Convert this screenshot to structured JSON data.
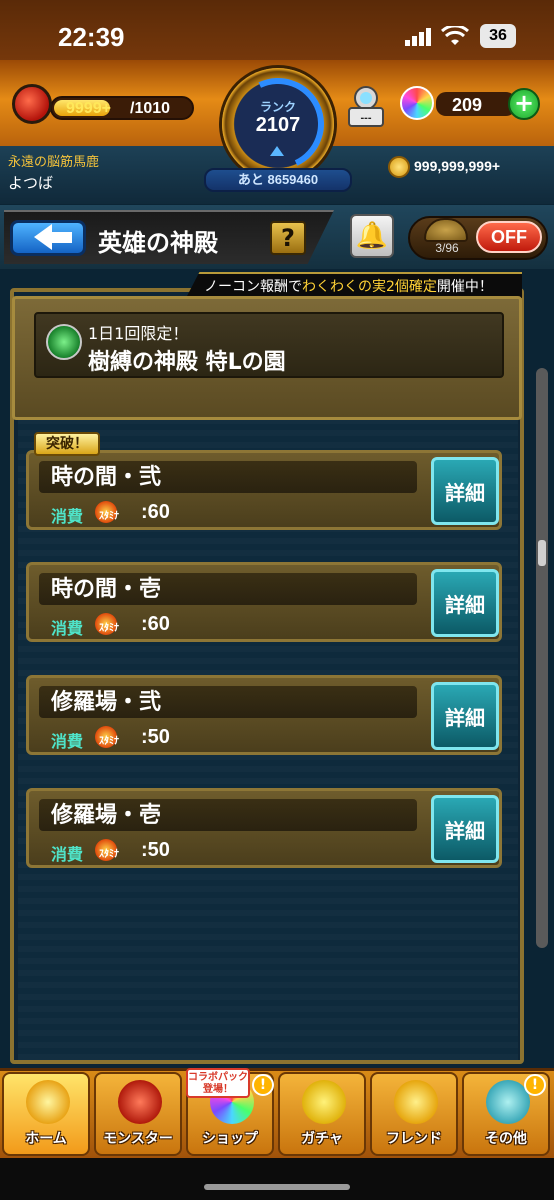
{
  "status_bar": {
    "time": "22:39",
    "battery": "36"
  },
  "hud": {
    "stamina_current": "9999+",
    "stamina_max": "/1010",
    "rank_label": "ランク",
    "rank_value": "2107",
    "rank_next": "あと 8659460",
    "machine_value": "---",
    "orb_count": "209",
    "plus_label": "+",
    "player_title": "永遠の脳筋馬鹿",
    "player_name": "よつば",
    "coins": "999,999,999+"
  },
  "header": {
    "title": "英雄の神殿",
    "help_label": "?",
    "auto_count": "3/96",
    "auto_toggle": "OFF"
  },
  "notice": {
    "pre": "ノーコン報酬で",
    "highlight": "わくわくの実2個確定",
    "post": "開催中！"
  },
  "event": {
    "subtitle": "1日1回限定！",
    "title": "樹縛の神殿 特Lの園"
  },
  "break_badge": "突破！",
  "quests": [
    {
      "name": "時の間・弐",
      "cost_label": "消費",
      "stamina_label": "ｽﾀﾐﾅ",
      "cost": ":60",
      "detail": "詳細"
    },
    {
      "name": "時の間・壱",
      "cost_label": "消費",
      "stamina_label": "ｽﾀﾐﾅ",
      "cost": ":60",
      "detail": "詳細"
    },
    {
      "name": "修羅場・弐",
      "cost_label": "消費",
      "stamina_label": "ｽﾀﾐﾅ",
      "cost": ":50",
      "detail": "詳細"
    },
    {
      "name": "修羅場・壱",
      "cost_label": "消費",
      "stamina_label": "ｽﾀﾐﾅ",
      "cost": ":50",
      "detail": "詳細"
    }
  ],
  "bottom_nav": {
    "collab_badge": "コラボパック登場！",
    "badge": "!",
    "tabs": [
      {
        "label": "ホーム",
        "icon": "home-icon"
      },
      {
        "label": "モンスター",
        "icon": "monster-icon"
      },
      {
        "label": "ショップ",
        "icon": "shop-icon"
      },
      {
        "label": "ガチャ",
        "icon": "gacha-icon"
      },
      {
        "label": "フレンド",
        "icon": "friend-icon"
      },
      {
        "label": "その他",
        "icon": "other-icon"
      }
    ]
  }
}
